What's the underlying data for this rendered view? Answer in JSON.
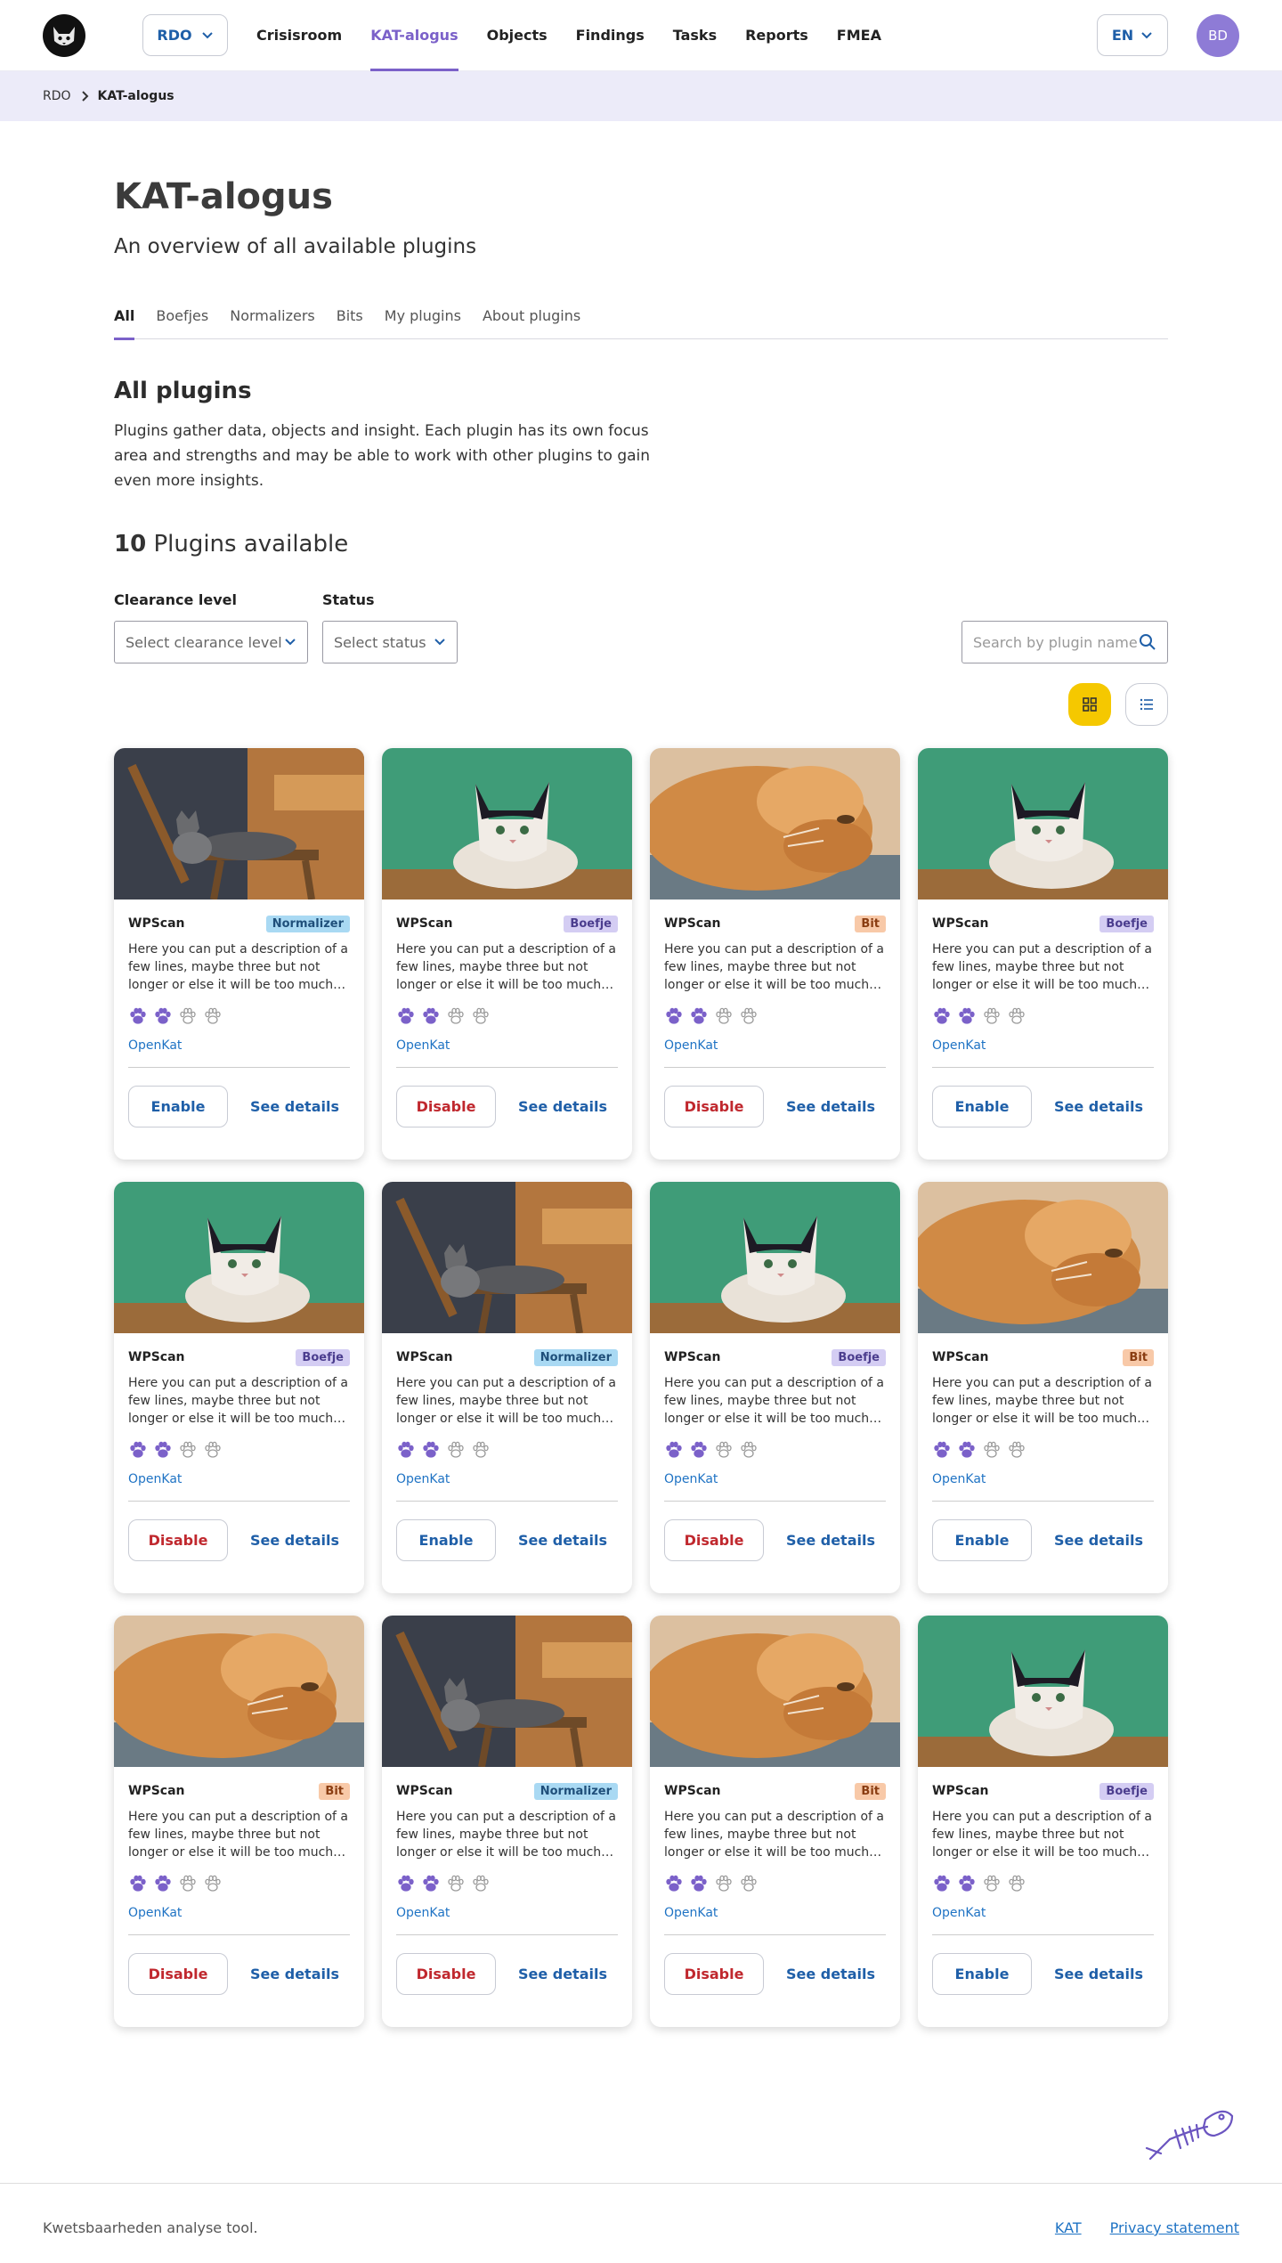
{
  "header": {
    "org_label": "RDO",
    "nav": [
      "Crisisroom",
      "KAT-alogus",
      "Objects",
      "Findings",
      "Tasks",
      "Reports",
      "FMEA"
    ],
    "active_nav": "KAT-alogus",
    "lang_label": "EN",
    "avatar_initials": "BD"
  },
  "breadcrumb": {
    "root": "RDO",
    "current": "KAT-alogus"
  },
  "page": {
    "title": "KAT-alogus",
    "subtitle": "An overview of all available plugins",
    "tabs": [
      "All",
      "Boefjes",
      "Normalizers",
      "Bits",
      "My plugins",
      "About plugins"
    ],
    "active_tab": "All",
    "section_title": "All plugins",
    "intro": "Plugins gather data, objects and insight. Each plugin has its own focus area and strengths and may be able to work with other plugins to gain even more insights.",
    "count_number": "10",
    "count_label": "Plugins available"
  },
  "filters": {
    "clearance_label": "Clearance level",
    "clearance_placeholder": "Select clearance level",
    "status_label": "Status",
    "status_placeholder": "Select status",
    "search_placeholder": "Search by plugin name"
  },
  "view_toggle": {
    "grid_icon": "grid-icon",
    "list_icon": "list-icon",
    "active": "grid"
  },
  "colors": {
    "accent": "#7b61c9",
    "link": "#1f5fa8",
    "danger": "#c0282e",
    "view_active": "#f5c800"
  },
  "cards": [
    {
      "name": "WPScan",
      "type": "Normalizer",
      "image": "cat-on-chair",
      "desc": "Here you can put a description of a few lines, maybe three but not longer or else it will be too much…",
      "paws": 2,
      "org": "OpenKat",
      "action": "Enable",
      "details": "See details"
    },
    {
      "name": "WPScan",
      "type": "Boefje",
      "image": "cat-on-green",
      "desc": "Here you can put a description of a few lines, maybe three but not longer or else it will be too much…",
      "paws": 2,
      "org": "OpenKat",
      "action": "Disable",
      "details": "See details"
    },
    {
      "name": "WPScan",
      "type": "Bit",
      "image": "ginger-cat",
      "desc": "Here you can put a description of a few lines, maybe three but not longer or else it will be too much…",
      "paws": 2,
      "org": "OpenKat",
      "action": "Disable",
      "details": "See details"
    },
    {
      "name": "WPScan",
      "type": "Boefje",
      "image": "cat-on-green",
      "desc": "Here you can put a description of a few lines, maybe three but not longer or else it will be too much…",
      "paws": 2,
      "org": "OpenKat",
      "action": "Enable",
      "details": "See details"
    },
    {
      "name": "WPScan",
      "type": "Boefje",
      "image": "cat-on-green",
      "desc": "Here you can put a description of a few lines, maybe three but not longer or else it will be too much…",
      "paws": 2,
      "org": "OpenKat",
      "action": "Disable",
      "details": "See details"
    },
    {
      "name": "WPScan",
      "type": "Normalizer",
      "image": "cat-on-chair",
      "desc": "Here you can put a description of a few lines, maybe three but not longer or else it will be too much…",
      "paws": 2,
      "org": "OpenKat",
      "action": "Enable",
      "details": "See details"
    },
    {
      "name": "WPScan",
      "type": "Boefje",
      "image": "cat-on-green",
      "desc": "Here you can put a description of a few lines, maybe three but not longer or else it will be too much…",
      "paws": 2,
      "org": "OpenKat",
      "action": "Disable",
      "details": "See details"
    },
    {
      "name": "WPScan",
      "type": "Bit",
      "image": "ginger-cat",
      "desc": "Here you can put a description of a few lines, maybe three but not longer or else it will be too much…",
      "paws": 2,
      "org": "OpenKat",
      "action": "Enable",
      "details": "See details"
    },
    {
      "name": "WPScan",
      "type": "Bit",
      "image": "ginger-cat",
      "desc": "Here you can put a description of a few lines, maybe three but not longer or else it will be too much…",
      "paws": 2,
      "org": "OpenKat",
      "action": "Disable",
      "details": "See details"
    },
    {
      "name": "WPScan",
      "type": "Normalizer",
      "image": "cat-on-chair",
      "desc": "Here you can put a description of a few lines, maybe three but not longer or else it will be too much…",
      "paws": 2,
      "org": "OpenKat",
      "action": "Disable",
      "details": "See details"
    },
    {
      "name": "WPScan",
      "type": "Bit",
      "image": "ginger-cat",
      "desc": "Here you can put a description of a few lines, maybe three but not longer or else it will be too much…",
      "paws": 2,
      "org": "OpenKat",
      "action": "Disable",
      "details": "See details"
    },
    {
      "name": "WPScan",
      "type": "Boefje",
      "image": "cat-on-green",
      "desc": "Here you can put a description of a few lines, maybe three but not longer or else it will be too much…",
      "paws": 2,
      "org": "OpenKat",
      "action": "Enable",
      "details": "See details"
    }
  ],
  "footer": {
    "text": "Kwetsbaarheden analyse tool.",
    "links": [
      "KAT",
      "Privacy statement"
    ]
  }
}
